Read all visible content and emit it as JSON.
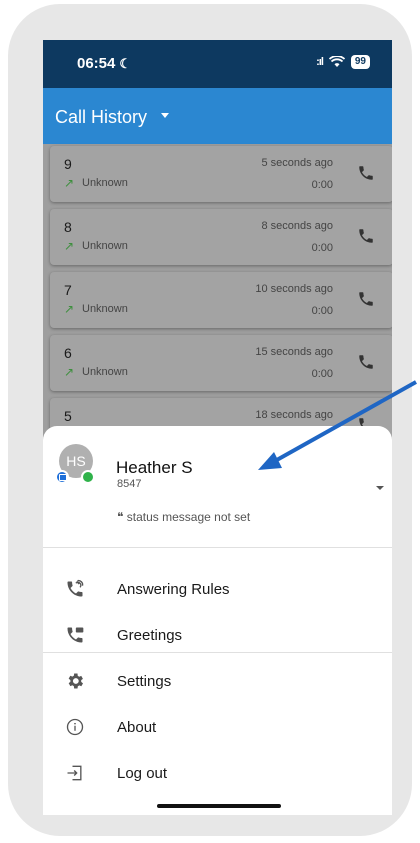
{
  "status_bar": {
    "time": "06:54",
    "battery": "99"
  },
  "app_bar": {
    "title": "Call History"
  },
  "calls": [
    {
      "number": "9",
      "direction": "↗",
      "status": "Unknown",
      "time_ago": "5 seconds ago",
      "duration": "0:00"
    },
    {
      "number": "8",
      "direction": "↗",
      "status": "Unknown",
      "time_ago": "8 seconds ago",
      "duration": "0:00"
    },
    {
      "number": "7",
      "direction": "↗",
      "status": "Unknown",
      "time_ago": "10 seconds ago",
      "duration": "0:00"
    },
    {
      "number": "6",
      "direction": "↗",
      "status": "Unknown",
      "time_ago": "15 seconds ago",
      "duration": "0:00"
    },
    {
      "number": "5",
      "time_ago": "18 seconds ago"
    }
  ],
  "user": {
    "initials": "HS",
    "name": "Heather S",
    "extension": "8547",
    "status_message": "❝ status message not set"
  },
  "menu": [
    {
      "label": "Answering Rules",
      "icon": "answering-rules-icon"
    },
    {
      "label": "Greetings",
      "icon": "greetings-icon"
    },
    {
      "label": "Settings",
      "icon": "gear-icon"
    },
    {
      "label": "About",
      "icon": "info-icon"
    },
    {
      "label": "Log out",
      "icon": "logout-icon"
    }
  ],
  "colors": {
    "status_bar": "#0d3960",
    "app_bar": "#2b87d1",
    "annotation_arrow": "#1f66c4",
    "outgoing_call": "#3d8f3d"
  }
}
